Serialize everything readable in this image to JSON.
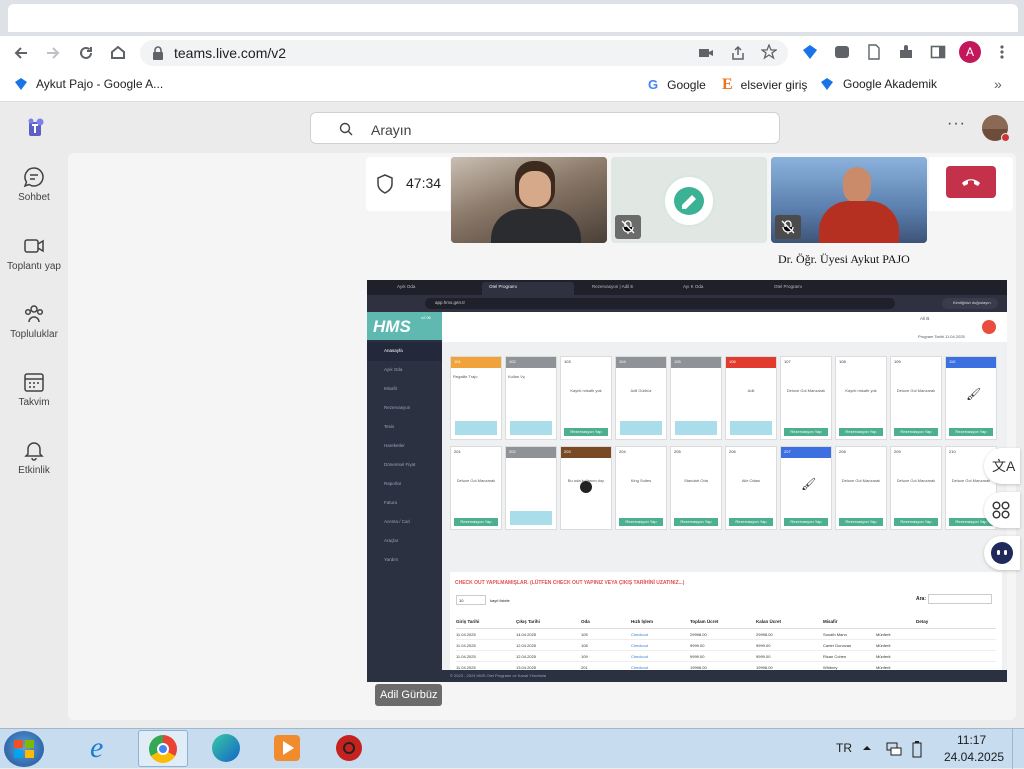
{
  "browser": {
    "url": "teams.live.com/v2",
    "profile_initial": "A",
    "bookmarks": [
      "Aykut Pajo - Google A...",
      "Google",
      "elsevier giriş",
      "Google Akademik"
    ],
    "more": "»"
  },
  "teams": {
    "search_placeholder": "Arayın",
    "more": "···",
    "rail": [
      {
        "label": "Sohbet"
      },
      {
        "label": "Toplantı yap"
      },
      {
        "label": "Topluluklar"
      },
      {
        "label": "Takvim"
      },
      {
        "label": "Etkinlik"
      }
    ],
    "call": {
      "timer": "47:34",
      "participant_name": "Dr. Öğr. Üyesi Aykut PAJO",
      "presenter_label": "Adil Gürbüz"
    }
  },
  "shared_screen": {
    "tabs": [
      "Ayık Oda",
      "Otel Programı",
      "Rezervasyon | Adil E",
      "Ayı K Oda",
      "Otel Programı"
    ],
    "url": "app.hms.gen.tr",
    "logo": "HMS",
    "version": "v2.06",
    "update_button": "Kimliğinizi doğrulayın",
    "user": "Ali B.",
    "program_date": "Program Tarihi 11.04.2025",
    "sidebar": [
      "Anasayfa",
      "Ayık Oda",
      "Misafir",
      "Rezervasyon",
      "Tesis",
      "Hareketler",
      "Dönemsel Fiyat",
      "Raporlar",
      "Fatura",
      "Acenta / Cari",
      "Araçlar",
      "Yardım"
    ],
    "rooms_row1": [
      {
        "no": "101",
        "color": "#f0a23b",
        "name": "Regaille Trajo",
        "state": "occupied"
      },
      {
        "no": "102",
        "color": "#8f9297",
        "name": "Kullan Vç",
        "state": "occupied"
      },
      {
        "no": "103",
        "color": "#ffffff",
        "name": "Kayıtlı misafir yok",
        "state": "empty"
      },
      {
        "no": "104",
        "color": "#8f9297",
        "name": "Adil Gürbüz",
        "state": "dates"
      },
      {
        "no": "105",
        "color": "#8f9297",
        "name": "",
        "state": "dates"
      },
      {
        "no": "106",
        "color": "#e03b2e",
        "name": "Adil",
        "state": "dates"
      },
      {
        "no": "107",
        "color": "#ffffff",
        "name": "Deluxe Gol Manzaralı",
        "state": "free"
      },
      {
        "no": "108",
        "color": "#ffffff",
        "name": "Kayıtlı misafir yok",
        "state": "empty"
      },
      {
        "no": "109",
        "color": "#ffffff",
        "name": "Deluxe Gol Manzaralı",
        "state": "free"
      },
      {
        "no": "110",
        "color": "#3c6fe0",
        "name": "",
        "state": "clean"
      }
    ],
    "rooms_row2": [
      {
        "no": "201",
        "color": "#ffffff",
        "name": "Deluxe Gol Manzaralı",
        "state": "free"
      },
      {
        "no": "202",
        "color": "#8f9297",
        "name": "",
        "state": "debt"
      },
      {
        "no": "203",
        "color": "#7a4a26",
        "name": "Bu oda kullanım dışı",
        "state": "blocked"
      },
      {
        "no": "204",
        "color": "#ffffff",
        "name": "King Suites",
        "state": "free"
      },
      {
        "no": "205",
        "color": "#ffffff",
        "name": "Standart Oda",
        "state": "free"
      },
      {
        "no": "206",
        "color": "#ffffff",
        "name": "Aile Odası",
        "state": "free"
      },
      {
        "no": "207",
        "color": "#3c6fe0",
        "name": "",
        "state": "clean"
      },
      {
        "no": "208",
        "color": "#ffffff",
        "name": "Deluxe Gol Manzaralı",
        "state": "free"
      },
      {
        "no": "209",
        "color": "#ffffff",
        "name": "Deluxe Gol Manzaralı",
        "state": "free"
      },
      {
        "no": "210",
        "color": "#ffffff",
        "name": "Deluxe Gol Manzaralı",
        "state": "free"
      }
    ],
    "reservation_button": "Rezervasyon Yap",
    "checkout_title": "CHECK OUT YAPILMAMIŞLAR. (LÜTFEN CHECK OUT YAPINIZ VEYA ÇIKIŞ TARİHİNİ UZATINIZ...)",
    "page_size": "10",
    "page_size_label": "kayıt listele",
    "search_label": "Ara:",
    "columns": [
      "Giriş Tarihi",
      "Çıkış Tarihi",
      "Oda",
      "Hızlı İşlem",
      "Toplam Ücret",
      "Kalan Ücret",
      "Misafir",
      "",
      "Detay",
      ""
    ],
    "rows": [
      [
        "11.04.2025",
        "14.04.2025",
        "105",
        "Checkout",
        "29998.00",
        "29998.00",
        "Sonath Mann",
        "Münferit"
      ],
      [
        "11.04.2025",
        "12.04.2025",
        "108",
        "Checkout",
        "9999.00",
        "9999.00",
        "Carter Donovan",
        "Münferit"
      ],
      [
        "11.04.2025",
        "12.04.2025",
        "109",
        "Checkout",
        "9999.00",
        "9999.00",
        "Rizan Cohen",
        "Münferit"
      ],
      [
        "11.04.2025",
        "13.04.2025",
        "201",
        "Checkout",
        "19998.00",
        "19998.00",
        "Whitney",
        "Münferit"
      ]
    ],
    "footer": "© 2023 - 2024 HMS Otel Programı ve Kanal Yöneticisi"
  },
  "taskbar": {
    "lang": "TR",
    "time": "11:17",
    "date": "24.04.2025"
  }
}
